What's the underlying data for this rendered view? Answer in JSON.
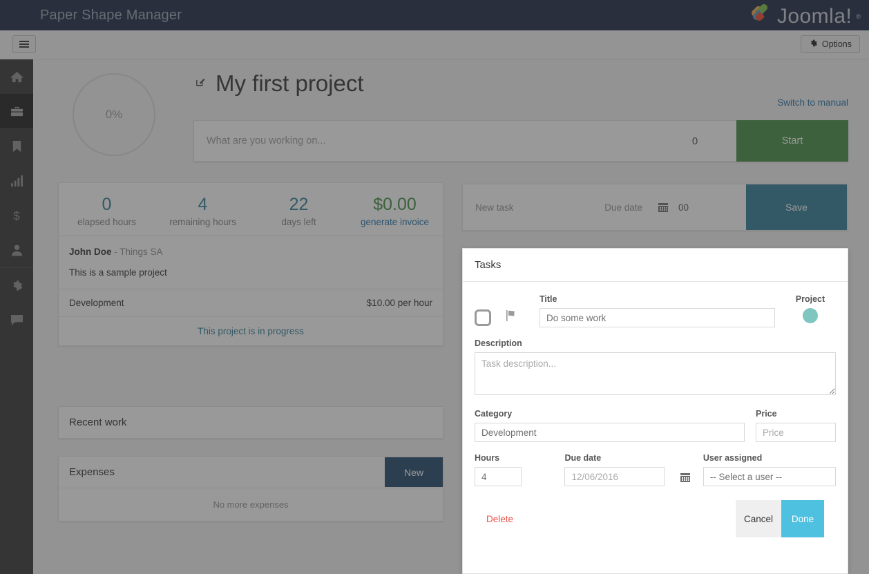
{
  "topbar": {
    "title": "Paper Shape Manager",
    "brand": "Joomla!",
    "brand_tm": "®"
  },
  "subheader": {
    "menu_icon": "hamburger-icon",
    "options_label": "Options",
    "options_icon": "gear-icon"
  },
  "sidebar": {
    "items": [
      {
        "name": "home",
        "icon": "home-icon",
        "active": false
      },
      {
        "name": "projects",
        "icon": "briefcase-icon",
        "active": true
      },
      {
        "name": "bookmarks",
        "icon": "bookmark-icon",
        "active": false
      },
      {
        "name": "reports",
        "icon": "bar-chart-icon",
        "active": false
      },
      {
        "name": "invoices",
        "icon": "dollar-icon",
        "active": false
      },
      {
        "name": "clients",
        "icon": "user-icon",
        "active": false
      },
      {
        "name": "settings",
        "icon": "gear-icon",
        "active": false
      },
      {
        "name": "messages",
        "icon": "comment-icon",
        "active": false
      }
    ]
  },
  "project": {
    "progress_percent": "0%",
    "edit_icon": "edit-square-icon",
    "title": "My first project",
    "switch_manual_label": "Switch to manual",
    "timer": {
      "placeholder": "What are you working on...",
      "count": "0",
      "start_label": "Start"
    },
    "stats": [
      {
        "value": "0",
        "label": "elapsed hours",
        "color": "#2b7a94",
        "is_link": false
      },
      {
        "value": "4",
        "label": "remaining hours",
        "color": "#2b7a94",
        "is_link": false
      },
      {
        "value": "22",
        "label": "days left",
        "color": "#2b7a94",
        "is_link": false
      },
      {
        "value": "$0.00",
        "label": "generate invoice",
        "color": "#3d8b3d",
        "is_link": true
      }
    ],
    "client_name": "John Doe",
    "client_org": "- Things SA",
    "description": "This is a sample project",
    "category_name": "Development",
    "category_rate": "$10.00 per hour",
    "status_text": "This project is in progress"
  },
  "recent_work": {
    "title": "Recent work"
  },
  "expenses": {
    "title": "Expenses",
    "new_label": "New",
    "empty_text": "No more expenses"
  },
  "new_task_bar": {
    "title_placeholder": "New task",
    "due_date_label": "Due date",
    "calendar_icon": "calendar-icon",
    "hours_value": "00",
    "save_label": "Save"
  },
  "tasks_modal": {
    "heading": "Tasks",
    "checkbox_icon": "checkbox-unchecked-icon",
    "flag_icon": "flag-icon",
    "title_label": "Title",
    "title_value": "Do some work",
    "project_label": "Project",
    "project_color": "#7fc6c0",
    "description_label": "Description",
    "description_placeholder": "Task description...",
    "category_label": "Category",
    "category_value": "Development",
    "price_label": "Price",
    "price_placeholder": "Price",
    "hours_label": "Hours",
    "hours_value": "4",
    "due_date_label": "Due date",
    "due_date_placeholder": "12/06/2016",
    "calendar_icon": "calendar-icon",
    "user_label": "User assigned",
    "user_value": "-- Select a user --",
    "delete_label": "Delete",
    "cancel_label": "Cancel",
    "done_label": "Done"
  },
  "colors": {
    "topbar_bg": "#15233f",
    "start_green": "#3d8b3d",
    "save_teal": "#2b7a94",
    "new_navy": "#1d4468",
    "done_blue": "#4fc1e0",
    "delete_red": "#e8534a",
    "link_blue": "#1c6ea8"
  }
}
